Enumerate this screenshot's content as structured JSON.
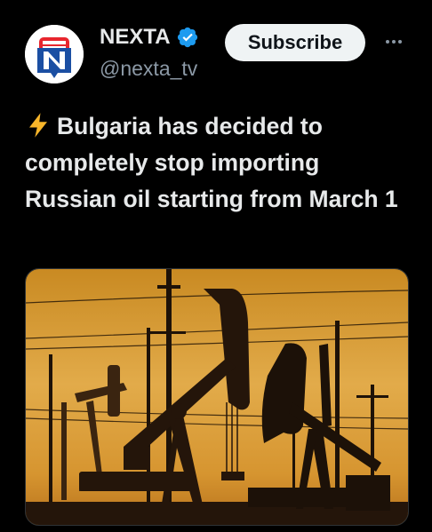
{
  "author": {
    "display_name": "NEXTA",
    "handle": "@nexta_tv",
    "verified": true,
    "avatar_letter": "N"
  },
  "actions": {
    "subscribe_label": "Subscribe"
  },
  "tweet": {
    "emoji": "lightning-icon",
    "text": "Bulgaria has decided to completely stop importing Russian oil starting from March 1"
  },
  "media": {
    "description_icon": "oil-pumpjacks-photo"
  },
  "colors": {
    "background": "#000000",
    "text": "#e7e9ea",
    "muted": "#8b98a5",
    "verified": "#1d9bf0",
    "brand_red": "#e8262e",
    "brand_blue": "#1b4fa3"
  }
}
